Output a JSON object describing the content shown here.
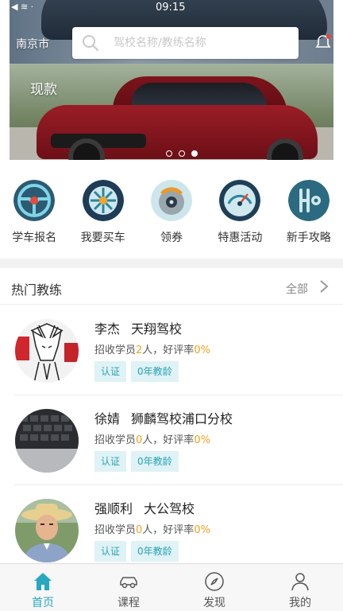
{
  "status_bar": {
    "time": "09:15"
  },
  "header": {
    "city": "南京市",
    "search": {
      "placeholder": "驾校名称/教练名称",
      "value": ""
    }
  },
  "banner": {
    "slogan": "现款",
    "slides": 3,
    "active_slide": 3
  },
  "quick_menu": [
    {
      "label": "学车报名",
      "icon": "steering-wheel-icon"
    },
    {
      "label": "我要买车",
      "icon": "car-wheel-icon"
    },
    {
      "label": "领券",
      "icon": "brake-disc-icon"
    },
    {
      "label": "特惠活动",
      "icon": "speedometer-icon"
    },
    {
      "label": "新手攻略",
      "icon": "gear-shift-icon"
    }
  ],
  "hot_coaches": {
    "title": "热门教练",
    "more_label": "全部",
    "items": [
      {
        "name": "李杰",
        "school": "天翔驾校",
        "stats_prefix": "招收学员",
        "students": "2",
        "stats_mid": "人，好评率",
        "rating": "0%",
        "tags": [
          "认证",
          "0年教龄"
        ]
      },
      {
        "name": "徐婧",
        "school": "狮麟驾校浦口分校",
        "stats_prefix": "招收学员",
        "students": "0",
        "stats_mid": "人，好评率",
        "rating": "0%",
        "tags": [
          "认证",
          "0年教龄"
        ]
      },
      {
        "name": "强顺利",
        "school": "大公驾校",
        "stats_prefix": "招收学员",
        "students": "0",
        "stats_mid": "人，好评率",
        "rating": "0%",
        "tags": [
          "认证",
          "0年教龄"
        ]
      }
    ]
  },
  "tabbar": [
    {
      "label": "首页",
      "icon": "home-icon",
      "active": true
    },
    {
      "label": "课程",
      "icon": "car-icon",
      "active": false
    },
    {
      "label": "发现",
      "icon": "compass-icon",
      "active": false
    },
    {
      "label": "我的",
      "icon": "user-icon",
      "active": false
    }
  ],
  "colors": {
    "accent": "#27a8bf",
    "highlight": "#f3a01b",
    "tag_bg": "#dff2f5"
  }
}
